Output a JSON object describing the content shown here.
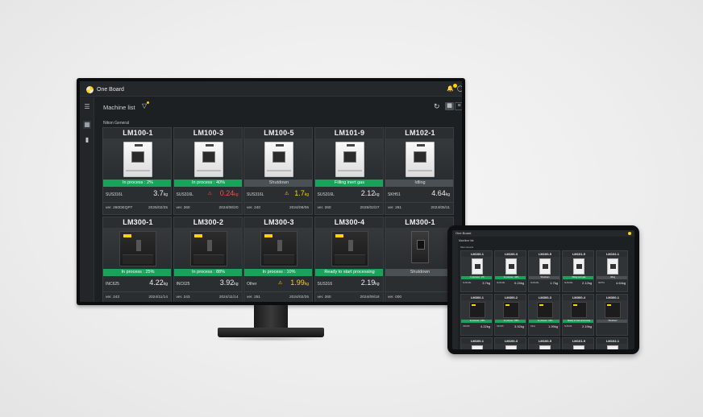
{
  "app": {
    "name": "One Board"
  },
  "toolbar": {
    "title": "Machine list"
  },
  "group": {
    "label": "Nikon General"
  },
  "colors": {
    "accent": "#ffd400",
    "status_green": "#17a35a",
    "warn_red": "#ff4b4b",
    "warn_yellow": "#ffd400"
  },
  "icons": [
    "menu-icon",
    "machine-icon",
    "chart-icon",
    "filter-icon",
    "refresh-icon",
    "grid-view-icon",
    "list-view-icon",
    "bell-icon",
    "user-icon",
    "warning-icon"
  ],
  "machines": [
    {
      "name": "LM100-1",
      "status": "In process : 2%",
      "status_color": "green",
      "material": "SUS316L",
      "weight": "3.7",
      "unit": "kg",
      "warning": "",
      "version": "ver. 260DEQP7",
      "date": "2025/02/25",
      "printer": "white"
    },
    {
      "name": "LM100-3",
      "status": "In process : 40%",
      "status_color": "green",
      "material": "SUS316L",
      "weight": "0.24",
      "unit": "kg",
      "warning": "red",
      "version": "ver. 260",
      "date": "2024/08/20",
      "printer": "white"
    },
    {
      "name": "LM100-5",
      "status": "Shutdown",
      "status_color": "gray",
      "material": "SUS316L",
      "weight": "1.7",
      "unit": "kg",
      "warning": "yellow",
      "version": "ver. 240",
      "date": "2024/08/06",
      "printer": "white"
    },
    {
      "name": "LM101-9",
      "status": "Filling inert gas",
      "status_color": "green",
      "material": "SUS316L",
      "weight": "2.12",
      "unit": "kg",
      "warning": "",
      "version": "ver. 260",
      "date": "2025/02/27",
      "printer": "white"
    },
    {
      "name": "LM102-1",
      "status": "Idling",
      "status_color": "gray",
      "material": "SKH51",
      "weight": "4.64",
      "unit": "kg",
      "warning": "",
      "version": "ver. 261",
      "date": "2024/05/11",
      "printer": "white"
    },
    {
      "name": "LM300-1",
      "status": "In process : 25%",
      "status_color": "green",
      "material": "INC625",
      "weight": "4.22",
      "unit": "kg",
      "warning": "",
      "version": "ver. 243",
      "date": "2024/11/14",
      "printer": "dark"
    },
    {
      "name": "LM300-2",
      "status": "In process : 88%",
      "status_color": "green",
      "material": "INC625",
      "weight": "3.92",
      "unit": "kg",
      "warning": "",
      "version": "ver. 243",
      "date": "2024/11/14",
      "printer": "dark"
    },
    {
      "name": "LM300-3",
      "status": "In process : 10%",
      "status_color": "green",
      "material": "Other",
      "weight": "1.99",
      "unit": "kg",
      "warning": "yellow",
      "version": "ver. 251",
      "date": "2024/02/25",
      "printer": "dark"
    },
    {
      "name": "LM300-4",
      "status": "Ready to start processing",
      "status_color": "green",
      "material": "SUS316",
      "weight": "2.19",
      "unit": "kg",
      "warning": "",
      "version": "ver. 260",
      "date": "2024/09/18",
      "printer": "dark"
    },
    {
      "name": "LM300-1",
      "status": "Shutdown",
      "status_color": "gray",
      "material": "",
      "weight": "",
      "unit": "",
      "warning": "",
      "version": "ver. 000",
      "date": "",
      "printer": "dark2"
    }
  ]
}
